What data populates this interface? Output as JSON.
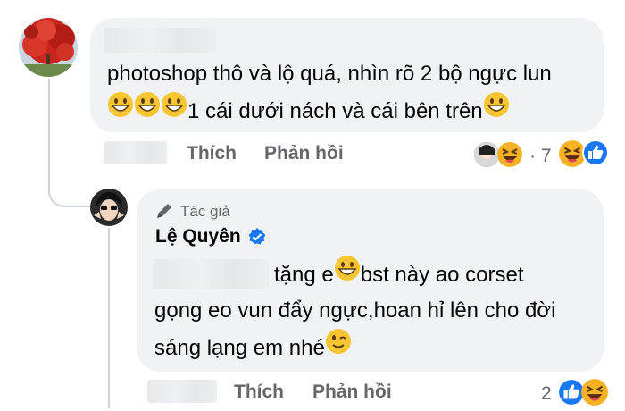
{
  "comments": [
    {
      "text_line1": "photoshop thô và lộ quá, nhìn rõ 2 bộ ngực lun",
      "text_line2_after_emoji": "1 cái dưới nách và cái bên trên",
      "actions": {
        "like": "Thích",
        "reply": "Phản hồi"
      },
      "reaction_separator": "· 7",
      "reaction_count": "7"
    },
    {
      "author_badge": "Tác giả",
      "author_name": "Lệ Quyên",
      "verified": true,
      "text_line1_before_emoji": "tặng e",
      "text_line1_after_emoji": "bst này ao corset",
      "text_line2": "gọng eo vun đẩy ngực,hoan hỉ lên cho đời",
      "text_line3": "sáng lạng em nhé",
      "actions": {
        "like": "Thích",
        "reply": "Phản hồi"
      },
      "reaction_count": "2"
    }
  ],
  "colors": {
    "bubble": "#f0f2f5",
    "text": "#050505",
    "muted": "#65676b",
    "like_blue": "#1877f2",
    "haha_yellow": "#f7b125"
  },
  "icons": [
    "grin-emoji-icon",
    "wink-emoji-icon",
    "like-reaction-icon",
    "haha-reaction-icon",
    "pen-icon",
    "verified-badge-icon"
  ]
}
